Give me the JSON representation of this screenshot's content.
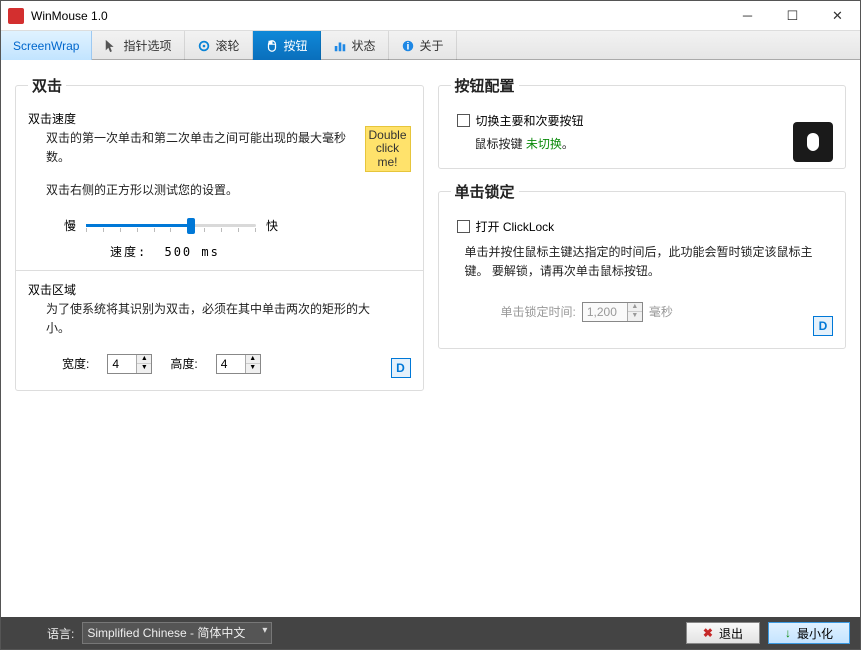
{
  "window": {
    "title": "WinMouse 1.0"
  },
  "tabs": [
    {
      "label": "ScreenWrap",
      "active": false,
      "first": true
    },
    {
      "label": "指针选项",
      "active": false
    },
    {
      "label": "滚轮",
      "active": false
    },
    {
      "label": "按钮",
      "active": true
    },
    {
      "label": "状态",
      "active": false
    },
    {
      "label": "关于",
      "active": false
    }
  ],
  "doubleclick": {
    "legend": "双击",
    "speed_label": "双击速度",
    "speed_desc": "双击的第一次单击和第二次单击之间可能出现的最大毫秒数。",
    "test_desc": "双击右侧的正方形以测试您的设置。",
    "slow": "慢",
    "fast": "快",
    "readout_label": "速度:",
    "readout_value": "500 ms",
    "yellow_text": "Double click me!"
  },
  "dczone": {
    "label": "双击区域",
    "desc": "为了使系统将其识别为双击，必须在其中单击两次的矩形的大小。",
    "width_label": "宽度:",
    "width_value": "4",
    "height_label": "高度:",
    "height_value": "4"
  },
  "btnconfig": {
    "legend": "按钮配置",
    "swap_label": "切换主要和次要按钮",
    "status_prefix": "鼠标按键",
    "status_value": "未切换",
    "status_suffix": "。"
  },
  "clicklock": {
    "legend": "单击锁定",
    "enable_label": "打开 ClickLock",
    "desc": "单击并按住鼠标主键达指定的时间后，此功能会暂时锁定该鼠标主键。 要解锁，请再次单击鼠标按钮。",
    "time_label": "单击锁定时间:",
    "time_value": "1,200",
    "time_unit": "毫秒"
  },
  "d_button": "D",
  "footer": {
    "lang_label": "语言:",
    "lang_value": "Simplified Chinese  -  简体中文",
    "exit": "退出",
    "minimize": "最小化"
  }
}
